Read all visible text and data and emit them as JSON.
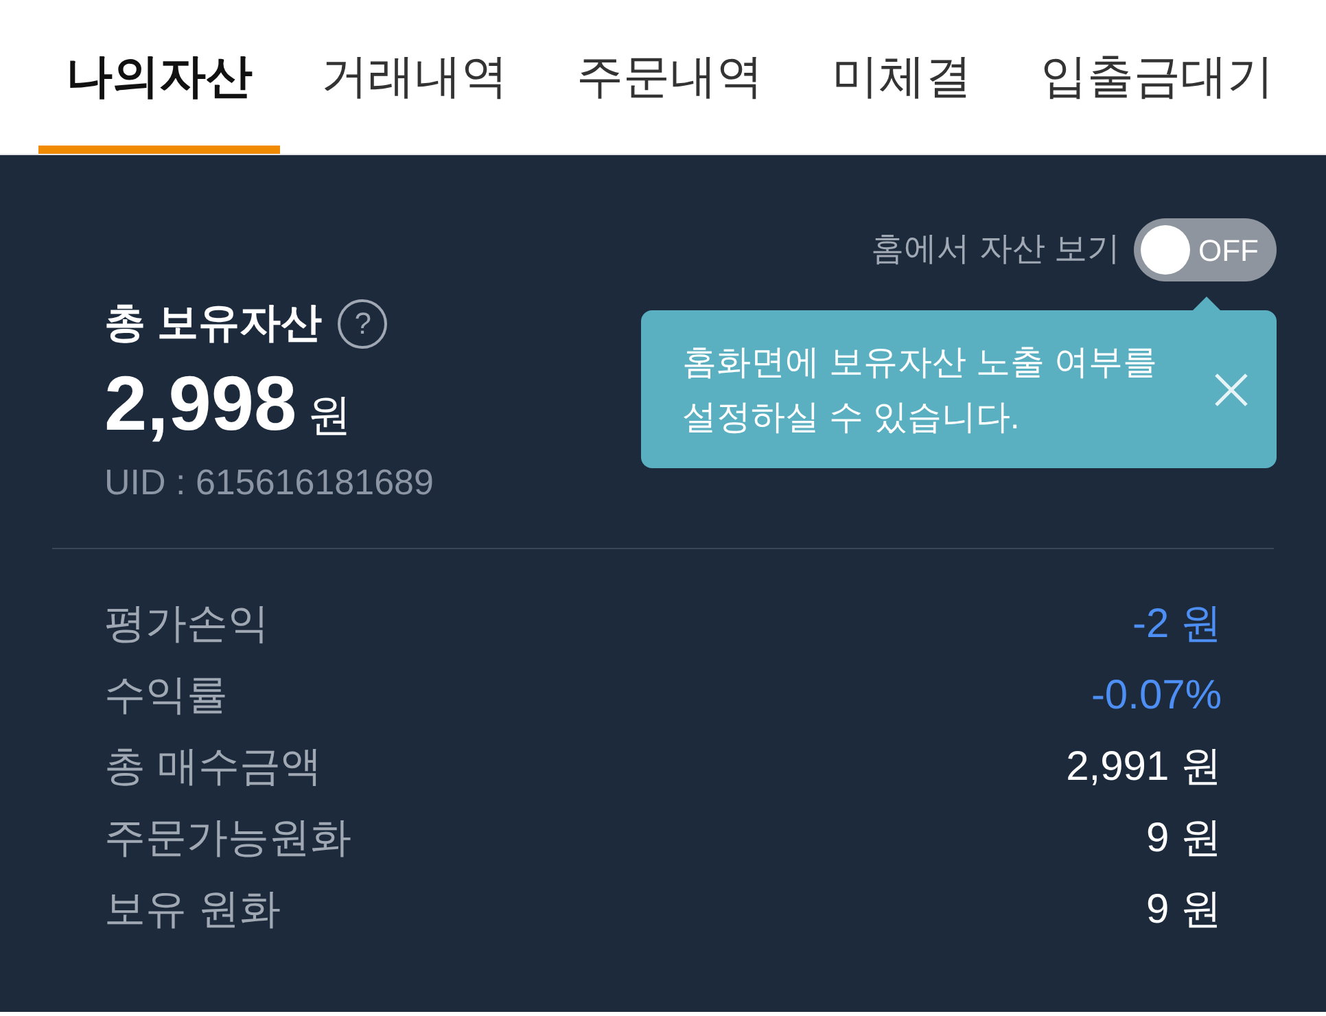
{
  "tabs": [
    {
      "label": "나의자산",
      "selected": true
    },
    {
      "label": "거래내역",
      "selected": false
    },
    {
      "label": "주문내역",
      "selected": false
    },
    {
      "label": "미체결",
      "selected": false
    },
    {
      "label": "입출금대기",
      "selected": false
    }
  ],
  "home_toggle": {
    "label": "홈에서 자산 보기",
    "on": false,
    "state_text": "OFF"
  },
  "tooltip": {
    "text": "홈화면에 보유자산 노출 여부를\n설정하실 수 있습니다."
  },
  "summary": {
    "title": "총 보유자산",
    "help": "?",
    "amount": "2,998",
    "unit": "원",
    "uid": "UID : 615616181689"
  },
  "rows": [
    {
      "label": "평가손익",
      "value": "-2 원",
      "kind": "negative"
    },
    {
      "label": "수익률",
      "value": "-0.07%",
      "kind": "negative"
    },
    {
      "label": "총 매수금액",
      "value": "2,991 원",
      "kind": "neutral"
    },
    {
      "label": "주문가능원화",
      "value": "9 원",
      "kind": "neutral"
    },
    {
      "label": "보유 원화",
      "value": "9 원",
      "kind": "neutral"
    }
  ]
}
